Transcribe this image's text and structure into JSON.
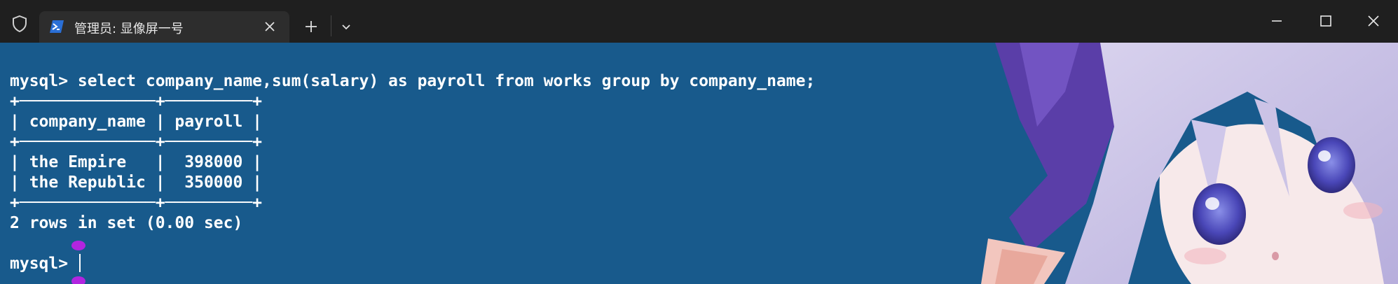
{
  "titlebar": {
    "tab_title": "管理员: 显像屏一号",
    "icons": {
      "shield": "shield-icon",
      "powershell": "powershell-icon",
      "close_tab": "close-icon",
      "new_tab": "plus-icon",
      "dropdown": "chevron-down-icon",
      "minimize": "minimize-icon",
      "maximize": "maximize-icon",
      "close_window": "close-icon"
    }
  },
  "terminal": {
    "background_color": "#185a8c",
    "text_color": "#ffffff",
    "lines": [
      "mysql> select company_name,sum(salary) as payroll from works group by company_name;",
      "+──────────────+─────────+",
      "| company_name | payroll |",
      "+──────────────+─────────+",
      "| the Empire   |  398000 |",
      "| the Republic |  350000 |",
      "+──────────────+─────────+",
      "2 rows in set (0.00 sec)",
      "",
      "mysql> "
    ],
    "result_table": {
      "columns": [
        "company_name",
        "payroll"
      ],
      "rows": [
        [
          "the Empire",
          "398000"
        ],
        [
          "the Republic",
          "350000"
        ]
      ]
    }
  }
}
